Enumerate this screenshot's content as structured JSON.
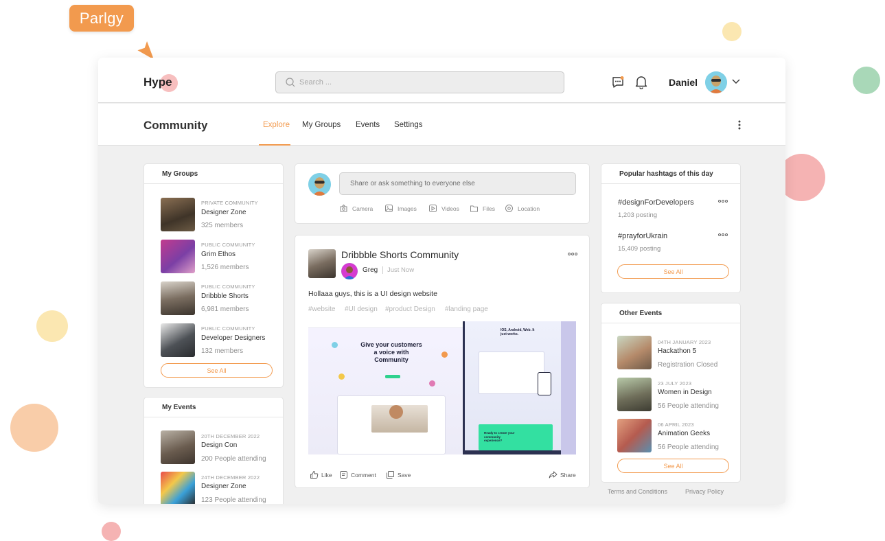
{
  "cursor_label": "Parlgy",
  "app": {
    "logo": "Hype",
    "search_placeholder": "Search ...",
    "user_name": "Daniel"
  },
  "subnav": {
    "title": "Community",
    "tabs": [
      "Explore",
      "My Groups",
      "Events",
      "Settings"
    ],
    "active_tab": "Explore"
  },
  "my_groups": {
    "title": "My Groups",
    "items": [
      {
        "kicker": "PRIVATE COMMUNITY",
        "title": "Designer Zone",
        "sub": "325 members"
      },
      {
        "kicker": "PUBLIC COMMUNITY",
        "title": "Grim Ethos",
        "sub": "1,526 members"
      },
      {
        "kicker": "PUBLIC COMMUNITY",
        "title": "Dribbble Shorts",
        "sub": "6,981 members"
      },
      {
        "kicker": "PUBLIC COMMUNITY",
        "title": "Developer Designers",
        "sub": "132 members"
      }
    ],
    "see_all": "See All"
  },
  "my_events": {
    "title": "My Events",
    "items": [
      {
        "kicker": "20TH DECEMBER 2022",
        "title": "Design Con",
        "sub": "200 People attending"
      },
      {
        "kicker": "24TH DECEMBER 2022",
        "title": "Designer Zone",
        "sub": "123 People attending"
      }
    ]
  },
  "composer": {
    "placeholder": "Share or ask something to everyone else",
    "attachments": [
      "Camera",
      "Images",
      "Videos",
      "Files",
      "Location"
    ]
  },
  "post": {
    "group": "Dribbble Shorts Community",
    "author": "Greg",
    "time": "Just Now",
    "text": "Hollaaa guys, this is a UI design website",
    "hashtags": [
      "#website",
      "#UI design",
      "#product Design",
      "#landing page"
    ],
    "image_headline": "Give your customers a voice with Community",
    "image_side_title": "IOS, Android, Web. It just works.",
    "image_cta": "Ready to create your community experience?",
    "actions": {
      "like": "Like",
      "comment": "Comment",
      "save": "Save",
      "share": "Share"
    }
  },
  "hashtags": {
    "title": "Popular hashtags of this day",
    "items": [
      {
        "tag": "#designForDevelopers",
        "count": "1,203 posting"
      },
      {
        "tag": "#prayforUkrain",
        "count": "15,409 posting"
      }
    ],
    "see_all": "See All"
  },
  "other_events": {
    "title": "Other Events",
    "items": [
      {
        "kicker": "04TH JANUARY 2023",
        "title": "Hackathon 5",
        "sub": "Registration Closed"
      },
      {
        "kicker": "23 JULY 2023",
        "title": "Women in Design",
        "sub": "56 People attending"
      },
      {
        "kicker": "06 APRIL 2023",
        "title": "Animation Geeks",
        "sub": "56 People attending"
      }
    ],
    "see_all": "See All"
  },
  "footer": {
    "terms": "Terms and Conditions",
    "privacy": "Privacy Policy"
  },
  "colors": {
    "accent": "#f29a4e",
    "background": "#f0f0f0"
  }
}
